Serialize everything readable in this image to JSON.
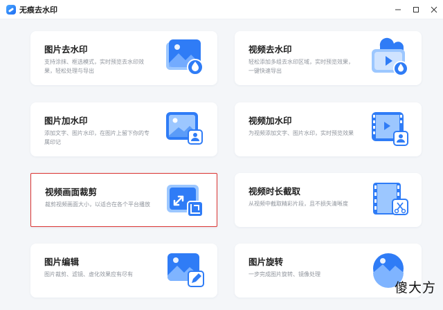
{
  "window": {
    "title": "无痕去水印",
    "controls": [
      "minimize",
      "maximize",
      "close"
    ]
  },
  "cards": [
    {
      "title": "图片去水印",
      "desc": "支持涂抹、框选模式，实时预览去水印效果，轻松处理与导出",
      "icon": "image-remove-watermark-icon"
    },
    {
      "title": "视频去水印",
      "desc": "轻松添加多组去水印区域，实时预览效果，一键快速导出",
      "icon": "video-remove-watermark-icon"
    },
    {
      "title": "图片加水印",
      "desc": "添加文字、图片水印，在图片上留下你的专属印记",
      "icon": "image-add-watermark-icon"
    },
    {
      "title": "视频加水印",
      "desc": "为视频添加文字、图片水印，实时预览效果",
      "icon": "video-add-watermark-icon"
    },
    {
      "title": "视频画面裁剪",
      "desc": "裁剪视频画面大小，以适合在各个平台播放",
      "icon": "video-crop-icon"
    },
    {
      "title": "视频时长截取",
      "desc": "从视频中截取精彩片段，且不损失清晰度",
      "icon": "video-trim-icon"
    },
    {
      "title": "图片编辑",
      "desc": "图片裁剪、滤镜、虚化效果应有尽有",
      "icon": "image-edit-icon"
    },
    {
      "title": "图片旋转",
      "desc": "一步完成图片旋转、镜像处理",
      "icon": "image-rotate-icon"
    }
  ],
  "selected_card": "视频画面裁剪",
  "watermark_text": "傻大方",
  "colors": {
    "accent_blue": "#2f7cf6",
    "light_blue": "#9cc7ff",
    "selection_red": "#d9302f",
    "background": "#f4f6f9"
  }
}
